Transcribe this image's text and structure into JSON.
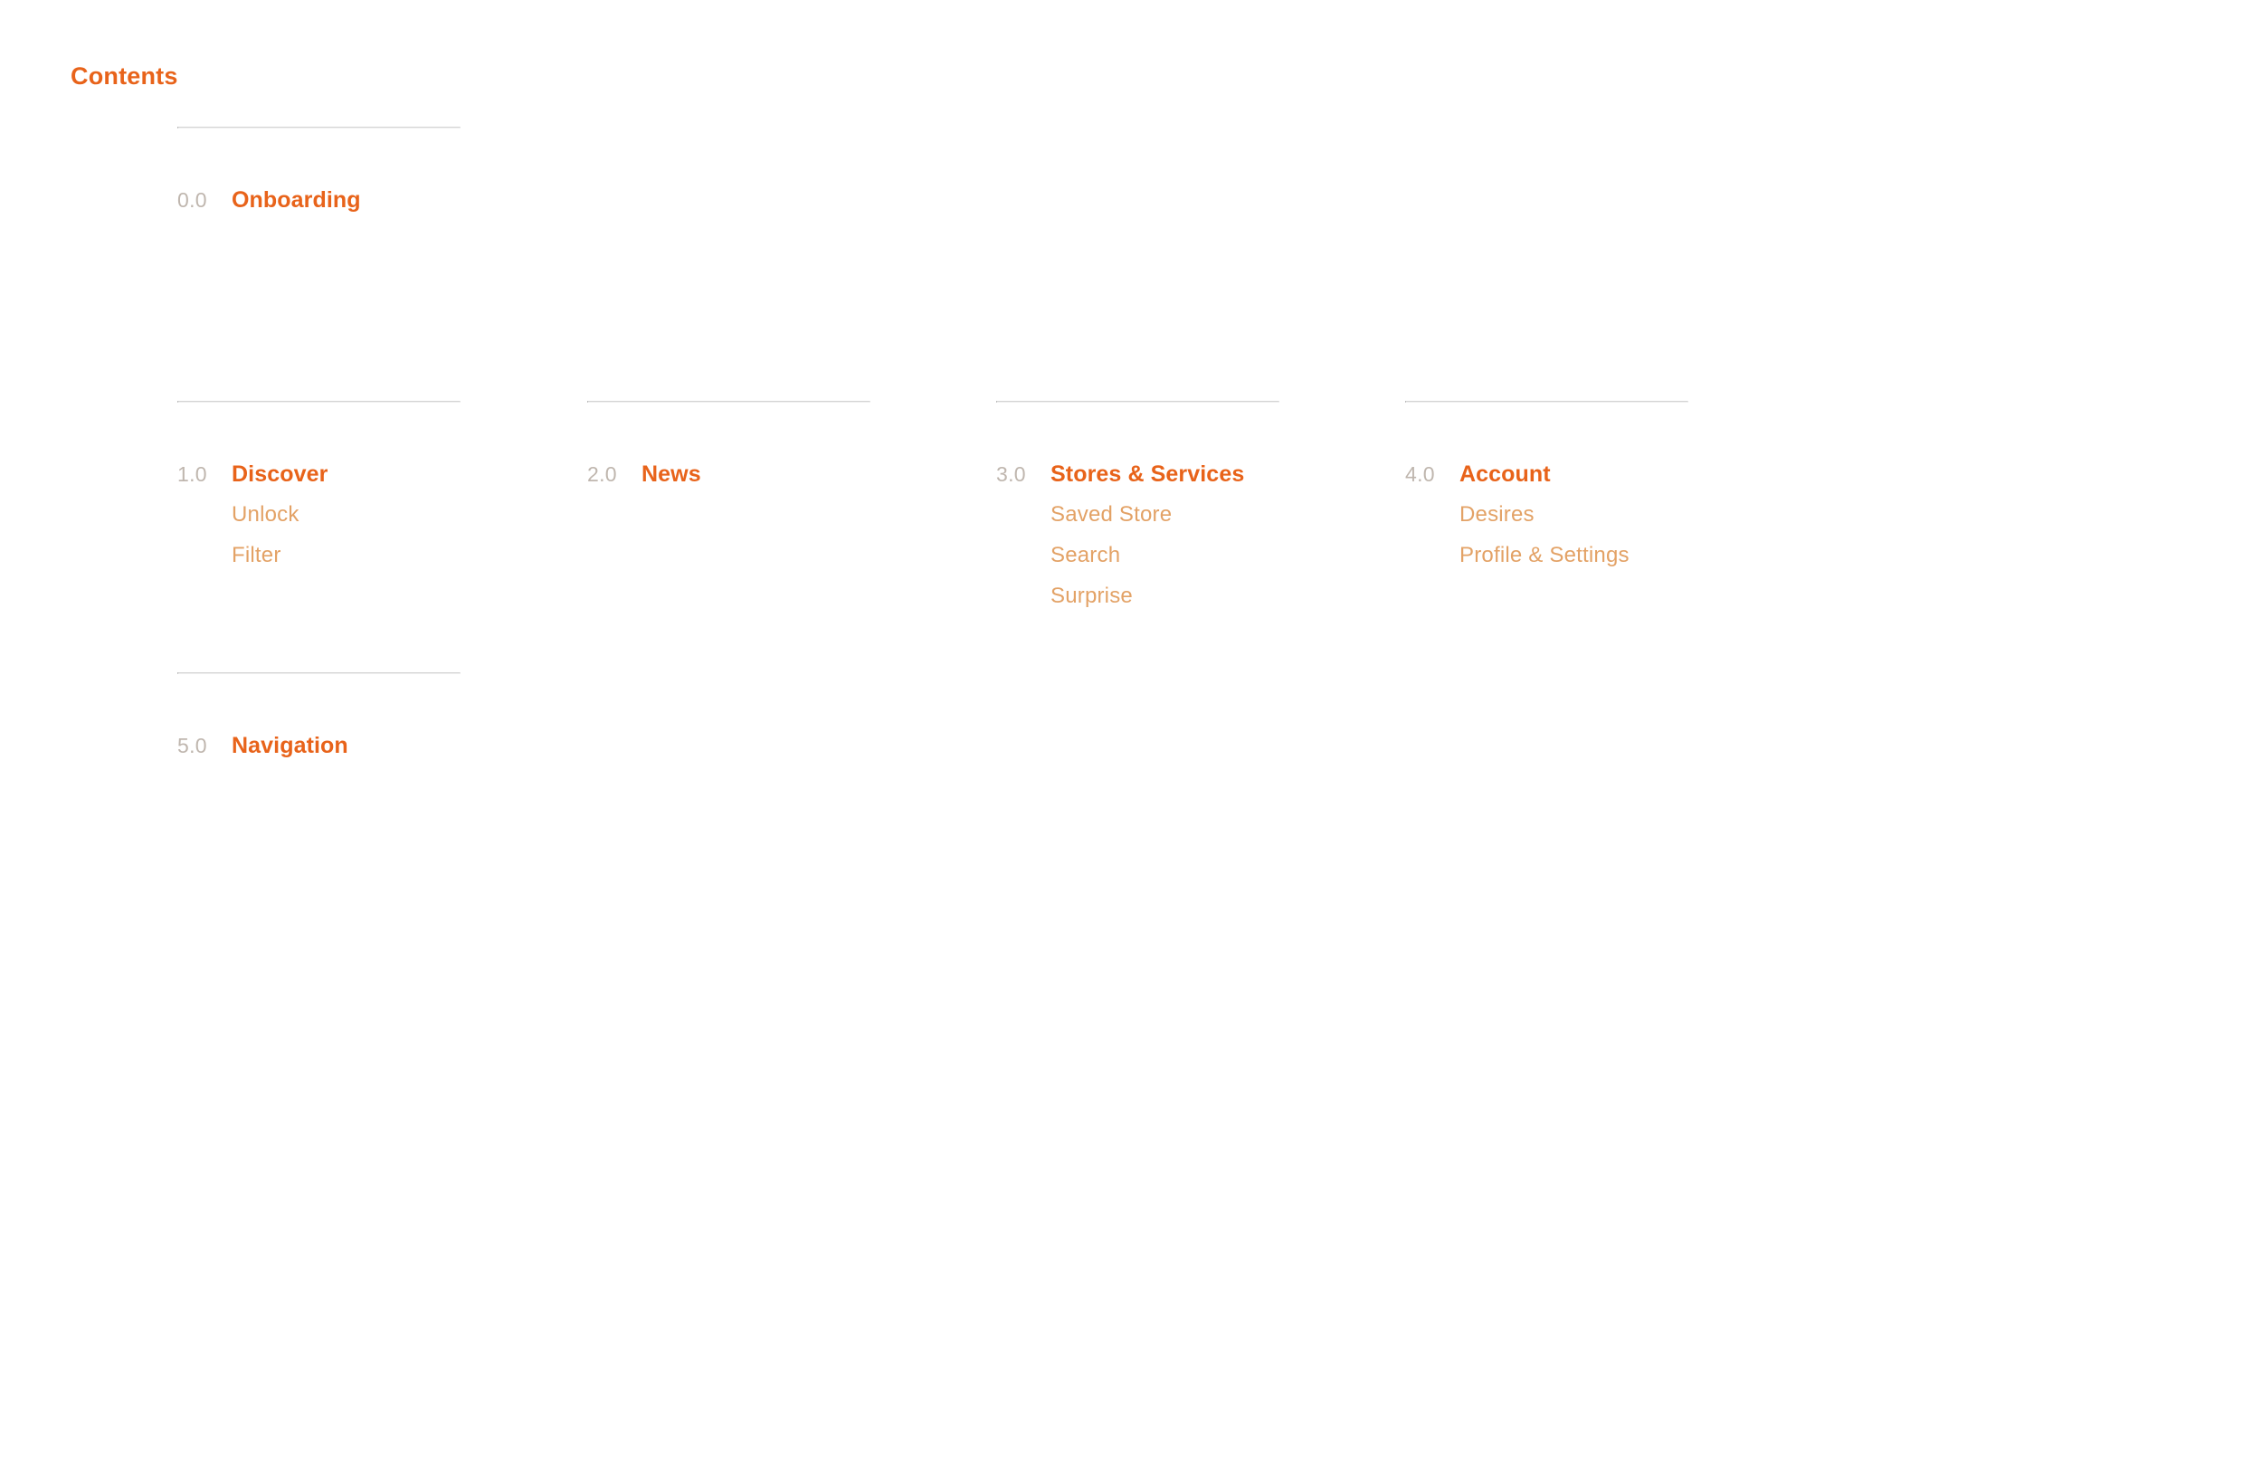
{
  "page": {
    "title": "Contents",
    "background_color": "#ffffff",
    "accent_color": "#e8631a",
    "number_color": "#bfb6ae",
    "subitem_color": "#e3a266",
    "divider_color": "#d4d4d4"
  },
  "toc": {
    "rows": [
      {
        "columns": [
          {
            "number": "0.0",
            "title": "Onboarding",
            "subitems": []
          },
          {
            "empty": true
          },
          {
            "empty": true
          },
          {
            "empty": true
          }
        ]
      },
      {
        "columns": [
          {
            "number": "1.0",
            "title": "Discover",
            "subitems": [
              "Unlock",
              "Filter"
            ]
          },
          {
            "number": "2.0",
            "title": "News",
            "subitems": []
          },
          {
            "number": "3.0",
            "title": "Stores & Services",
            "subitems": [
              "Saved Store",
              "Search",
              "Surprise"
            ]
          },
          {
            "number": "4.0",
            "title": "Account",
            "subitems": [
              "Desires",
              "Profile & Settings"
            ]
          }
        ]
      },
      {
        "columns": [
          {
            "number": "5.0",
            "title": "Navigation",
            "subitems": []
          },
          {
            "empty": true
          },
          {
            "empty": true
          },
          {
            "empty": true
          }
        ]
      }
    ]
  }
}
